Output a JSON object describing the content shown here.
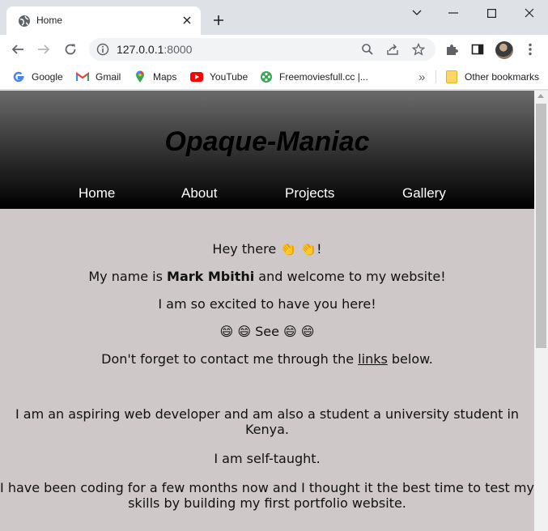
{
  "browser": {
    "tab_title": "Home",
    "url_host": "127.0.0.1",
    "url_port": ":8000",
    "bookmarks": [
      {
        "label": "Google",
        "icon": "google-icon"
      },
      {
        "label": "Gmail",
        "icon": "gmail-icon"
      },
      {
        "label": "Maps",
        "icon": "maps-icon"
      },
      {
        "label": "YouTube",
        "icon": "youtube-icon"
      },
      {
        "label": "Freemoviesfull.cc |...",
        "icon": "film-reel-icon"
      }
    ],
    "other_bookmarks": "Other bookmarks",
    "bookmarks_overflow": "»"
  },
  "site": {
    "title": "Opaque-Maniac",
    "nav": [
      "Home",
      "About",
      "Projects",
      "Gallery"
    ],
    "greeting": "Hey there 👏 👏!",
    "name_prefix": "My name is ",
    "name": "Mark Mbithi",
    "name_suffix": " and welcome to my website!",
    "excited": "I am so excited to have you here!",
    "see": "😄 😄 See 😄 😄",
    "contact_prefix": "Don't forget to contact me through the ",
    "contact_link": "links",
    "contact_suffix": " below.",
    "about_1": "I am an aspiring web developer and am also a student a university student in Kenya.",
    "about_2": "I am self-taught.",
    "about_3": "I have been coding for a few months now and I thought it the best time to test my skills by building my first portfolio website."
  },
  "colors": {
    "page_bg": "#cec8c8",
    "header_top": "#6b6b6b",
    "header_bottom": "#000000",
    "nav_text": "#ffffff"
  }
}
